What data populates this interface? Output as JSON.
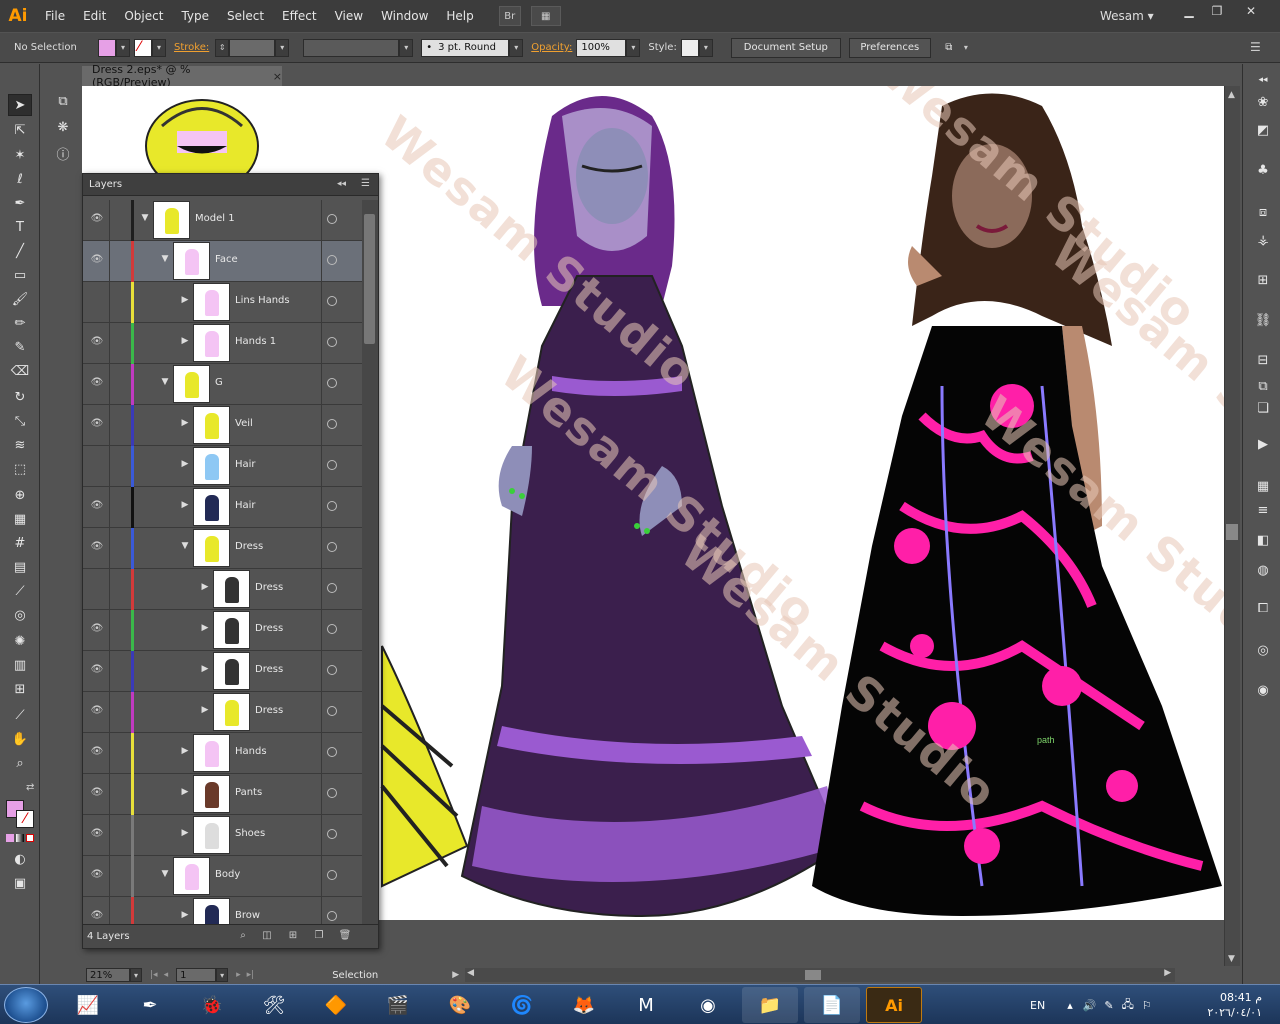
{
  "app": {
    "logo": "Ai",
    "user": "Wesam"
  },
  "menu": [
    "File",
    "Edit",
    "Object",
    "Type",
    "Select",
    "Effect",
    "View",
    "Window",
    "Help"
  ],
  "menubar_buttons": {
    "bridge": "Br",
    "arrange": "▦"
  },
  "control": {
    "selection": "No Selection",
    "stroke_label": "Stroke:",
    "brush": "3 pt. Round",
    "opacity_label": "Opacity:",
    "opacity_value": "100%",
    "style_label": "Style:",
    "document_setup": "Document Setup",
    "preferences": "Preferences"
  },
  "document": {
    "tab_title": "Dress 2.eps* @ % (RGB/Preview)",
    "close": "×"
  },
  "layers_panel": {
    "title": "Layers",
    "count": "4 Layers",
    "rows": [
      {
        "name": "Model 1",
        "color": "#1e1e1e",
        "level": 0,
        "expanded": true,
        "eye": true,
        "selected": false
      },
      {
        "name": "Face",
        "color": "#d23a3a",
        "level": 1,
        "expanded": true,
        "eye": true,
        "selected": true
      },
      {
        "name": "Lins Hands",
        "color": "#e8e03a",
        "level": 2,
        "expanded": false,
        "eye": false,
        "selected": false
      },
      {
        "name": "Hands 1",
        "color": "#3ab84a",
        "level": 2,
        "expanded": false,
        "eye": true,
        "selected": false
      },
      {
        "name": "G",
        "color": "#c03ac0",
        "level": 1,
        "expanded": true,
        "eye": true,
        "selected": false
      },
      {
        "name": "Veil",
        "color": "#3a3ab8",
        "level": 2,
        "expanded": false,
        "eye": true,
        "selected": false
      },
      {
        "name": "Hair",
        "color": "#3a5ad8",
        "level": 2,
        "expanded": false,
        "eye": false,
        "selected": false
      },
      {
        "name": "Hair",
        "color": "#111111",
        "level": 2,
        "expanded": false,
        "eye": true,
        "selected": false
      },
      {
        "name": "Dress",
        "color": "#3a5ad8",
        "level": 2,
        "expanded": true,
        "eye": true,
        "selected": false
      },
      {
        "name": "Dress",
        "color": "#d23a3a",
        "level": 3,
        "expanded": false,
        "eye": false,
        "selected": false
      },
      {
        "name": "Dress",
        "color": "#3ab84a",
        "level": 3,
        "expanded": false,
        "eye": true,
        "selected": false
      },
      {
        "name": "Dress",
        "color": "#3a3ab8",
        "level": 3,
        "expanded": false,
        "eye": true,
        "selected": false
      },
      {
        "name": "Dress",
        "color": "#c03ac0",
        "level": 3,
        "expanded": false,
        "eye": true,
        "selected": false
      },
      {
        "name": "Hands",
        "color": "#e8e03a",
        "level": 2,
        "expanded": false,
        "eye": true,
        "selected": false
      },
      {
        "name": "Pants",
        "color": "#e8e03a",
        "level": 2,
        "expanded": false,
        "eye": true,
        "selected": false
      },
      {
        "name": "Shoes",
        "color": "#7a7a7a",
        "level": 2,
        "expanded": false,
        "eye": true,
        "selected": false
      },
      {
        "name": "Body",
        "color": "#7a7a7a",
        "level": 1,
        "expanded": true,
        "eye": true,
        "selected": false
      },
      {
        "name": "Brow",
        "color": "#d23a3a",
        "level": 2,
        "expanded": false,
        "eye": true,
        "selected": false
      }
    ]
  },
  "canvas": {
    "path_label": "path",
    "watermark": "Wesam Studio"
  },
  "statusbar": {
    "zoom": "21%",
    "page": "1",
    "tool": "Selection"
  },
  "taskbar": {
    "lang": "EN",
    "time": "08:41 م",
    "date": "٢٠٢٦/٠٤/٠١",
    "apps": [
      "monitor",
      "pen",
      "bug",
      "tools",
      "vlc",
      "studio",
      "paint",
      "edge",
      "firefox",
      "maxthon",
      "chrome",
      "explorer",
      "text",
      "illustrator"
    ]
  },
  "colors": {
    "accent": "#ff9a00",
    "fill": "#e6a0e6",
    "purple_dress": "#3a1f4a",
    "pink": "#ff1fa8",
    "yellow": "#e8e82a"
  }
}
